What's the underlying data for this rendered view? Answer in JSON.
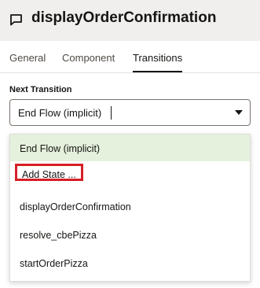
{
  "header": {
    "title": "displayOrderConfirmation",
    "icon": "chat-bubble-icon"
  },
  "tabs": [
    {
      "label": "General",
      "active": false
    },
    {
      "label": "Component",
      "active": false
    },
    {
      "label": "Transitions",
      "active": true
    }
  ],
  "next_transition": {
    "label": "Next Transition",
    "value": "End Flow (implicit)"
  },
  "dropdown": {
    "options": [
      {
        "label": "End Flow (implicit)",
        "selected": true
      },
      {
        "label": "Add State ...",
        "highlighted": true
      },
      {
        "label": "displayOrderConfirmation"
      },
      {
        "label": "resolve_cbePizza"
      },
      {
        "label": "startOrderPizza"
      }
    ]
  },
  "colors": {
    "selected_option_bg": "#e5f1dc",
    "highlight_border": "#d61f26",
    "header_bg": "#f1efed"
  }
}
